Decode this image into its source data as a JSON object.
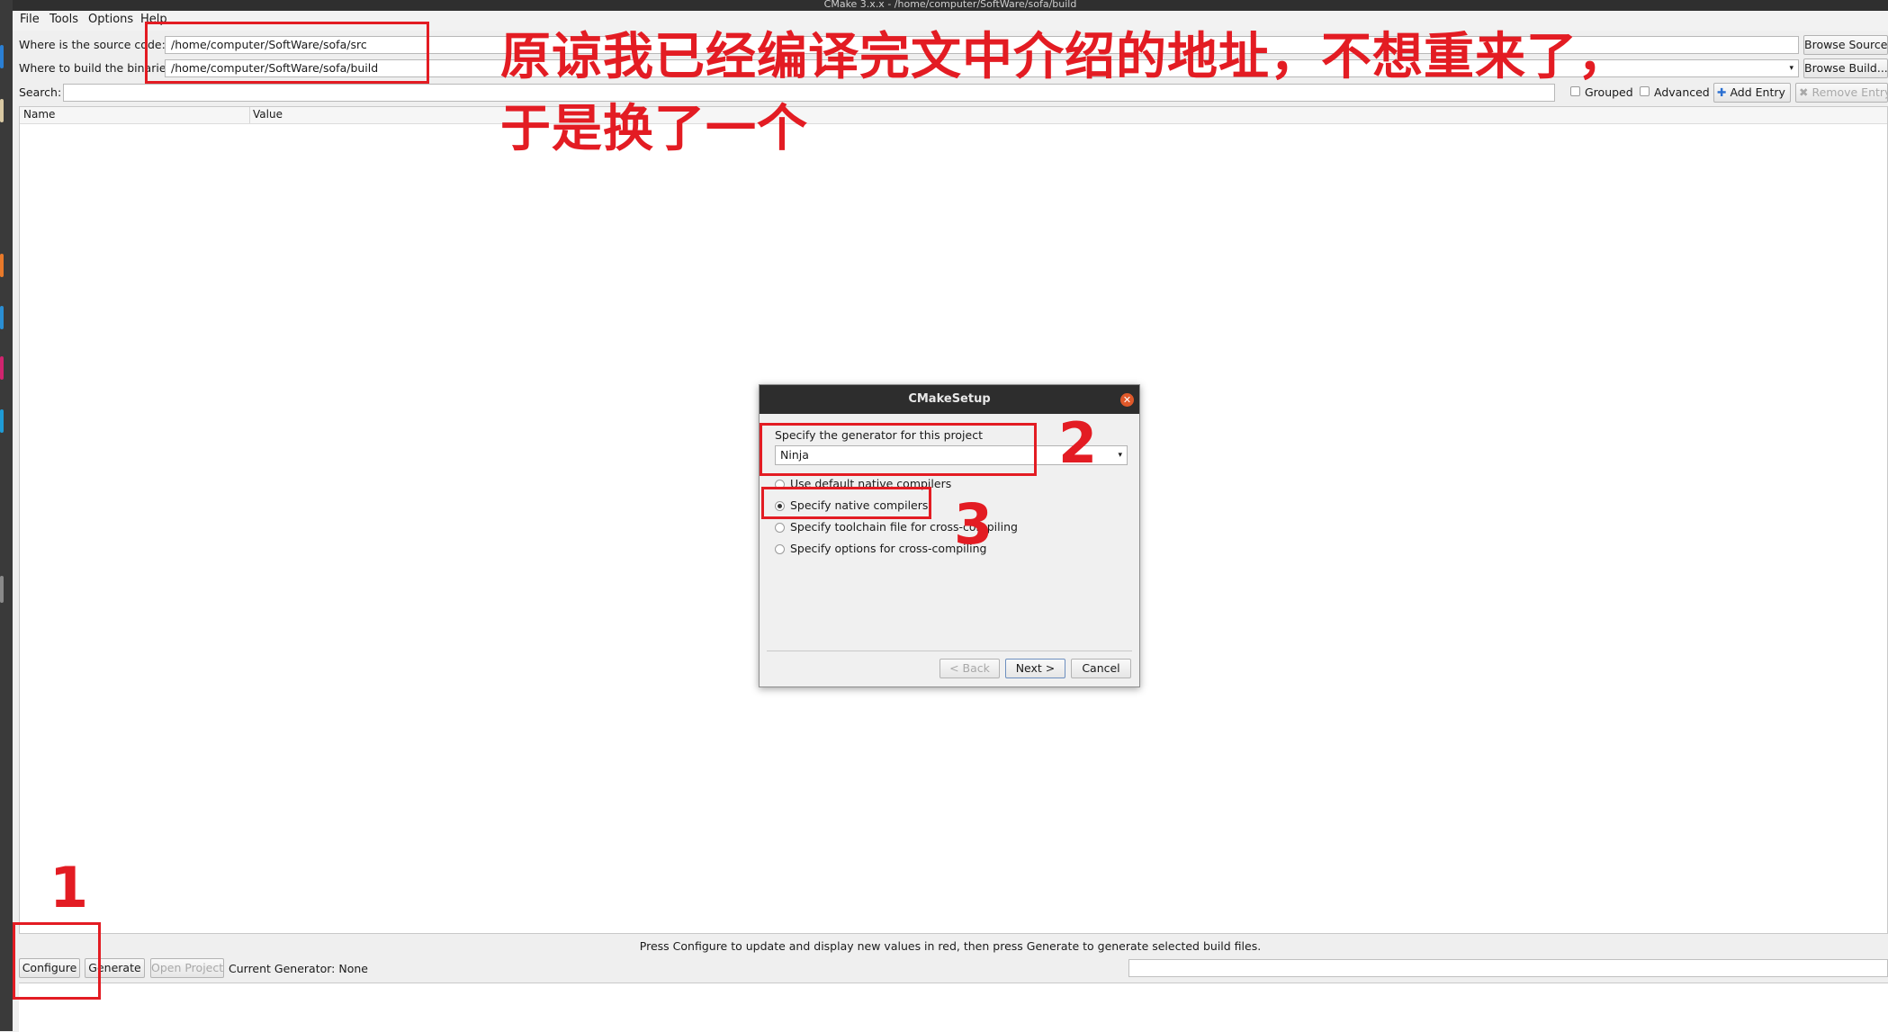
{
  "window": {
    "title": "CMake 3.x.x - /home/computer/SoftWare/sofa/build"
  },
  "menu": [
    "File",
    "Tools",
    "Options",
    "Help"
  ],
  "source": {
    "label": "Where is the source code:",
    "value": "/home/computer/SoftWare/sofa/src",
    "browse": "Browse Source..."
  },
  "build": {
    "label": "Where to build the binaries:",
    "value": "/home/computer/SoftWare/sofa/build",
    "browse": "Browse Build..."
  },
  "search": {
    "label": "Search:",
    "value": ""
  },
  "options": {
    "grouped": "Grouped",
    "advanced": "Advanced",
    "add_entry": "Add Entry",
    "remove_entry": "Remove Entry"
  },
  "table": {
    "col_name": "Name",
    "col_value": "Value"
  },
  "status": "Press Configure to update and display new values in red, then press Generate to generate selected build files.",
  "actions": {
    "configure": "Configure",
    "generate": "Generate",
    "open_project": "Open Project",
    "current_generator": "Current Generator: None"
  },
  "dialog": {
    "title": "CMakeSetup",
    "prompt": "Specify the generator for this project",
    "generator": "Ninja",
    "radios": [
      {
        "label": "Use default native compilers",
        "checked": false
      },
      {
        "label": "Specify native compilers",
        "checked": true
      },
      {
        "label": "Specify toolchain file for cross-compiling",
        "checked": false
      },
      {
        "label": "Specify options for cross-compiling",
        "checked": false
      }
    ],
    "back": "< Back",
    "next": "Next >",
    "cancel": "Cancel"
  },
  "annotations": {
    "line1": "原谅我已经编译完文中介绍的地址，不想重来了，",
    "line2": "于是换了一个",
    "step1": "1",
    "step2": "2",
    "step3": "3"
  },
  "colors": {
    "annotation": "#e31c23",
    "close_button": "#e0592a"
  }
}
